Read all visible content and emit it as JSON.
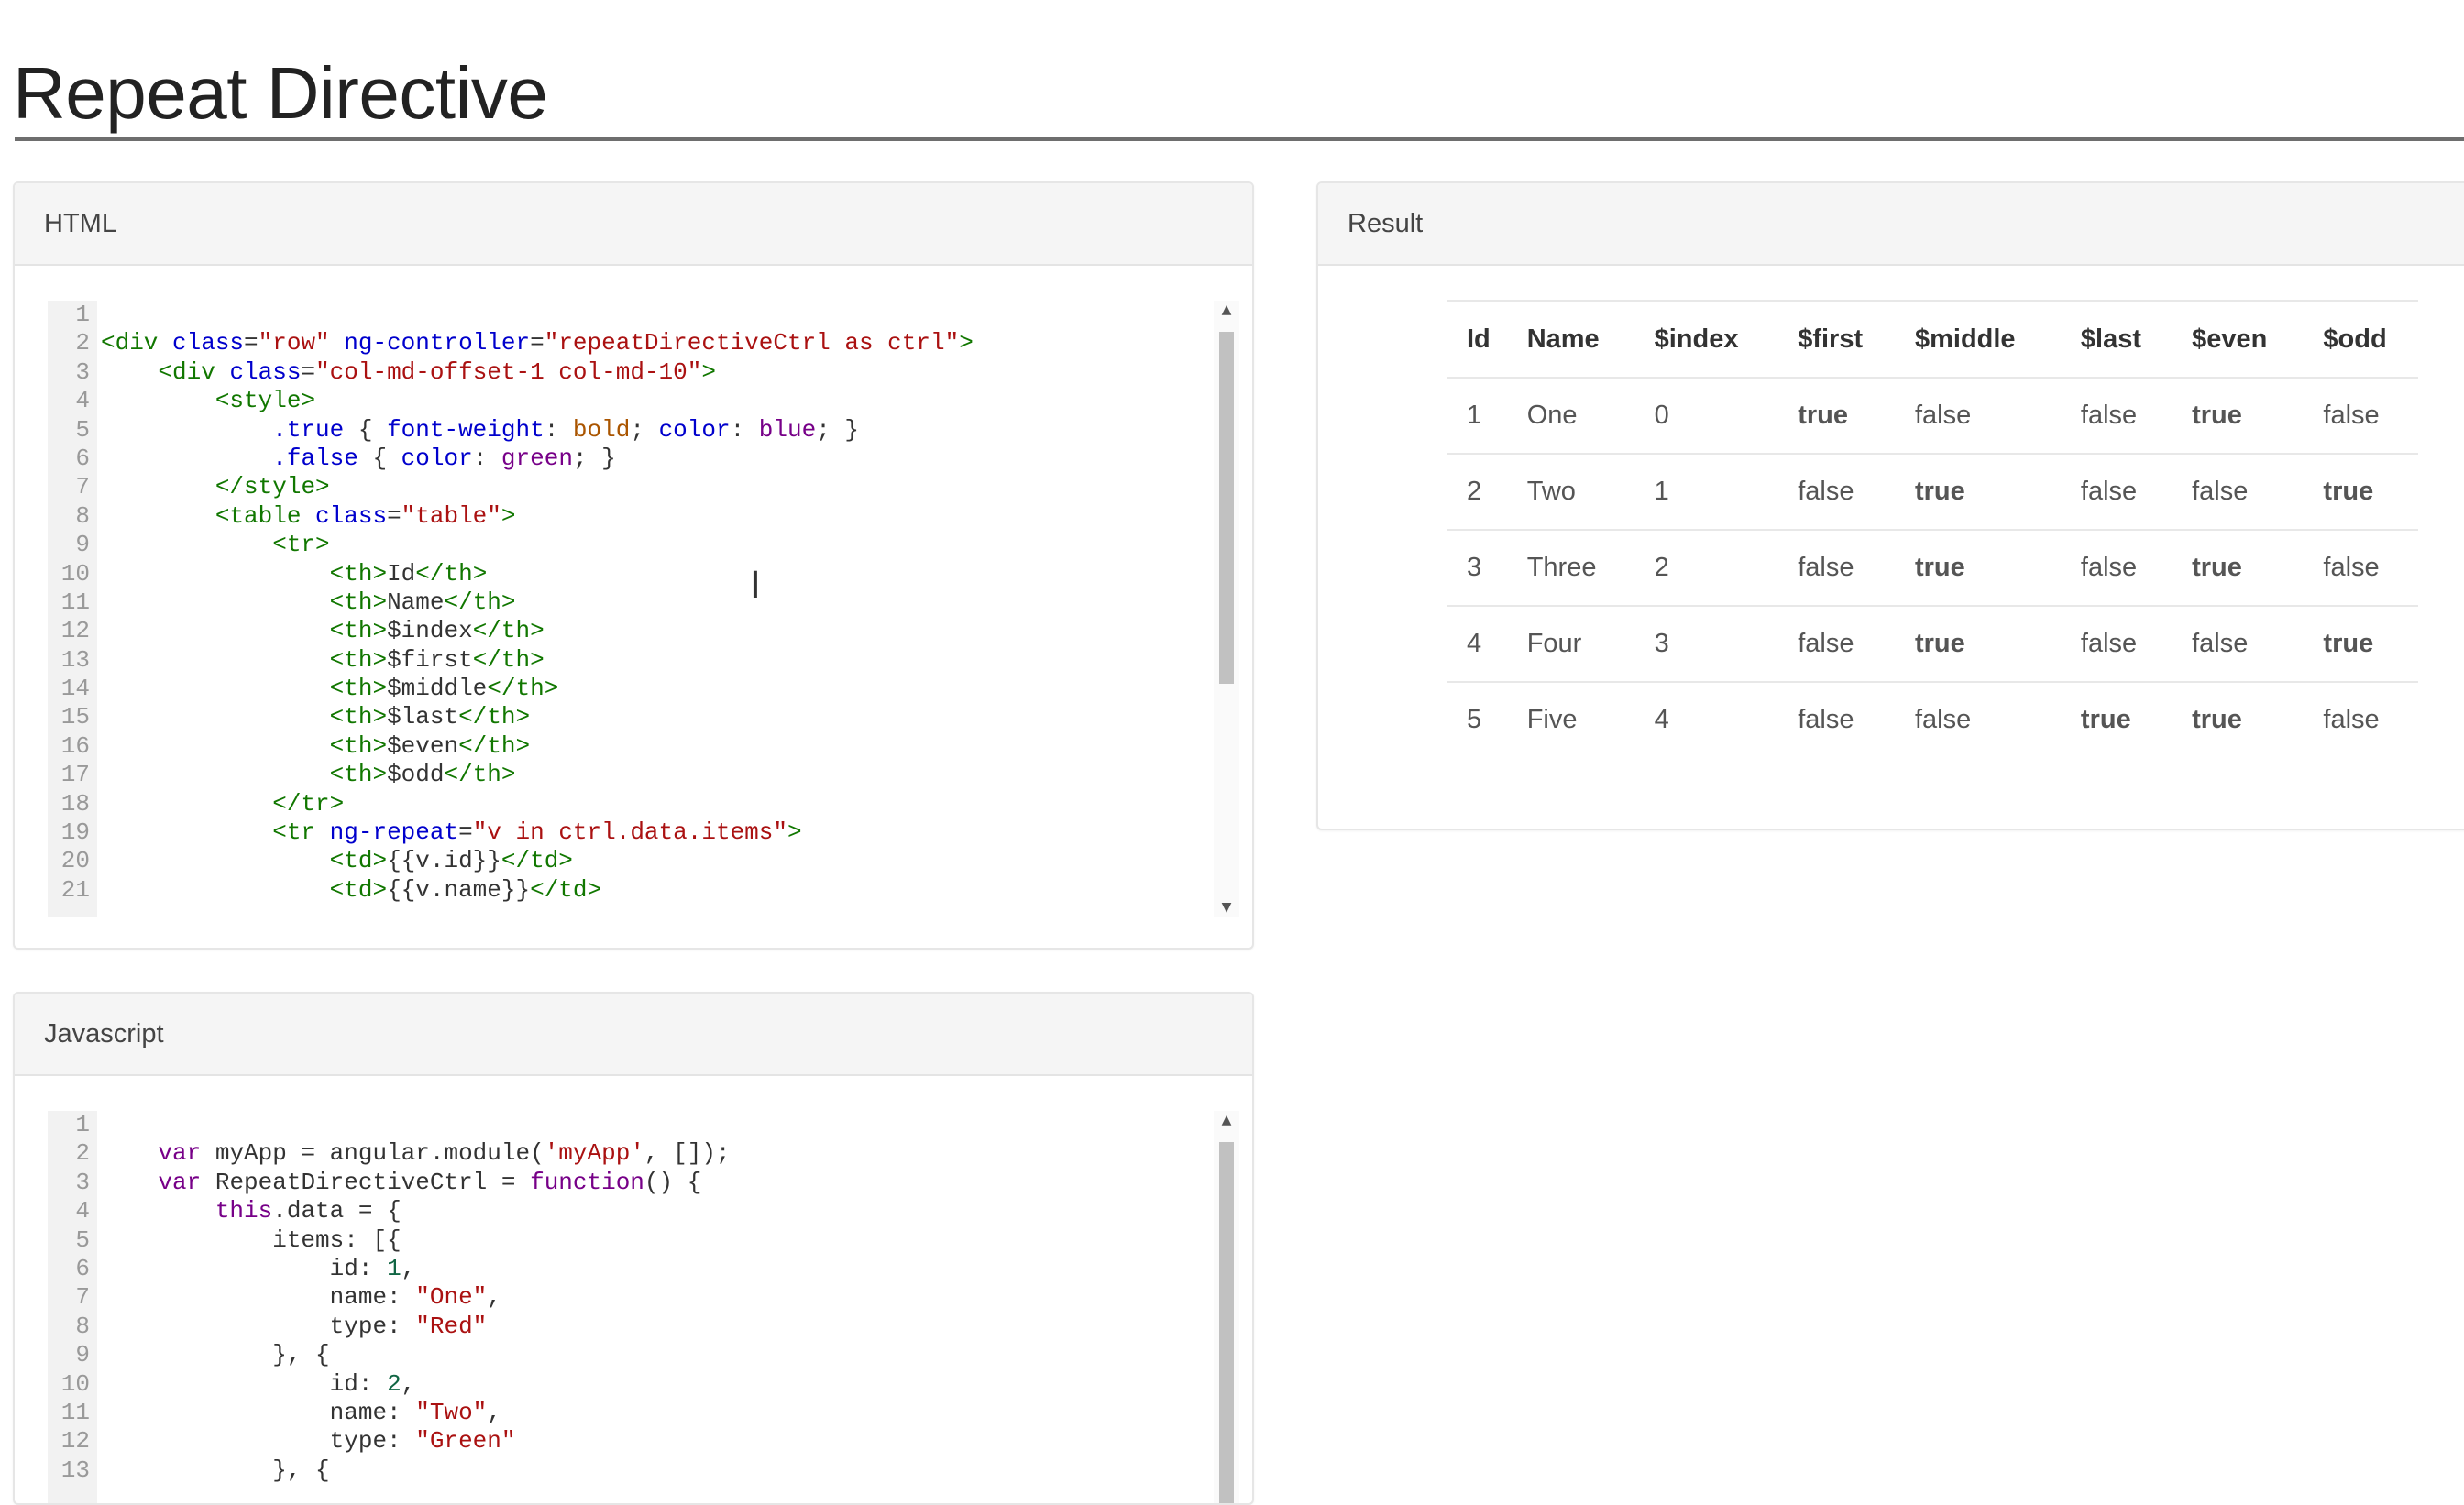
{
  "page": {
    "title": "Repeat Directive"
  },
  "html_panel": {
    "heading": "HTML",
    "line_numbers": [
      "1",
      "2",
      "3",
      "4",
      "5",
      "6",
      "7",
      "8",
      "9",
      "10",
      "11",
      "12",
      "13",
      "14",
      "15",
      "16",
      "17",
      "18",
      "19",
      "20",
      "21"
    ],
    "code_lines": [
      [],
      [
        {
          "t": "tag",
          "v": "<div "
        },
        {
          "t": "attr",
          "v": "class"
        },
        {
          "t": "",
          "v": "="
        },
        {
          "t": "str",
          "v": "\"row\""
        },
        {
          "t": "",
          "v": " "
        },
        {
          "t": "attr",
          "v": "ng-controller"
        },
        {
          "t": "",
          "v": "="
        },
        {
          "t": "str",
          "v": "\"repeatDirectiveCtrl as ctrl\""
        },
        {
          "t": "tag",
          "v": ">"
        }
      ],
      [
        {
          "t": "",
          "v": "    "
        },
        {
          "t": "tag",
          "v": "<div "
        },
        {
          "t": "attr",
          "v": "class"
        },
        {
          "t": "",
          "v": "="
        },
        {
          "t": "str",
          "v": "\"col-md-offset-1 col-md-10\""
        },
        {
          "t": "tag",
          "v": ">"
        }
      ],
      [
        {
          "t": "",
          "v": "        "
        },
        {
          "t": "tag",
          "v": "<style>"
        }
      ],
      [
        {
          "t": "",
          "v": "            "
        },
        {
          "t": "attr",
          "v": ".true"
        },
        {
          "t": "",
          "v": " { "
        },
        {
          "t": "cssprop",
          "v": "font-weight"
        },
        {
          "t": "",
          "v": ": "
        },
        {
          "t": "cssval",
          "v": "bold"
        },
        {
          "t": "",
          "v": "; "
        },
        {
          "t": "cssprop",
          "v": "color"
        },
        {
          "t": "",
          "v": ": "
        },
        {
          "t": "kw",
          "v": "blue"
        },
        {
          "t": "",
          "v": "; }"
        }
      ],
      [
        {
          "t": "",
          "v": "            "
        },
        {
          "t": "attr",
          "v": ".false"
        },
        {
          "t": "",
          "v": " { "
        },
        {
          "t": "cssprop",
          "v": "color"
        },
        {
          "t": "",
          "v": ": "
        },
        {
          "t": "kw",
          "v": "green"
        },
        {
          "t": "",
          "v": "; }"
        }
      ],
      [
        {
          "t": "",
          "v": "        "
        },
        {
          "t": "tag",
          "v": "</style>"
        }
      ],
      [
        {
          "t": "",
          "v": "        "
        },
        {
          "t": "tag",
          "v": "<table "
        },
        {
          "t": "attr",
          "v": "class"
        },
        {
          "t": "",
          "v": "="
        },
        {
          "t": "str",
          "v": "\"table\""
        },
        {
          "t": "tag",
          "v": ">"
        }
      ],
      [
        {
          "t": "",
          "v": "            "
        },
        {
          "t": "tag",
          "v": "<tr>"
        }
      ],
      [
        {
          "t": "",
          "v": "                "
        },
        {
          "t": "tag",
          "v": "<th>"
        },
        {
          "t": "",
          "v": "Id"
        },
        {
          "t": "tag",
          "v": "</th>"
        }
      ],
      [
        {
          "t": "",
          "v": "                "
        },
        {
          "t": "tag",
          "v": "<th>"
        },
        {
          "t": "",
          "v": "Name"
        },
        {
          "t": "tag",
          "v": "</th>"
        }
      ],
      [
        {
          "t": "",
          "v": "                "
        },
        {
          "t": "tag",
          "v": "<th>"
        },
        {
          "t": "",
          "v": "$index"
        },
        {
          "t": "tag",
          "v": "</th>"
        }
      ],
      [
        {
          "t": "",
          "v": "                "
        },
        {
          "t": "tag",
          "v": "<th>"
        },
        {
          "t": "",
          "v": "$first"
        },
        {
          "t": "tag",
          "v": "</th>"
        }
      ],
      [
        {
          "t": "",
          "v": "                "
        },
        {
          "t": "tag",
          "v": "<th>"
        },
        {
          "t": "",
          "v": "$middle"
        },
        {
          "t": "tag",
          "v": "</th>"
        }
      ],
      [
        {
          "t": "",
          "v": "                "
        },
        {
          "t": "tag",
          "v": "<th>"
        },
        {
          "t": "",
          "v": "$last"
        },
        {
          "t": "tag",
          "v": "</th>"
        }
      ],
      [
        {
          "t": "",
          "v": "                "
        },
        {
          "t": "tag",
          "v": "<th>"
        },
        {
          "t": "",
          "v": "$even"
        },
        {
          "t": "tag",
          "v": "</th>"
        }
      ],
      [
        {
          "t": "",
          "v": "                "
        },
        {
          "t": "tag",
          "v": "<th>"
        },
        {
          "t": "",
          "v": "$odd"
        },
        {
          "t": "tag",
          "v": "</th>"
        }
      ],
      [
        {
          "t": "",
          "v": "            "
        },
        {
          "t": "tag",
          "v": "</tr>"
        }
      ],
      [
        {
          "t": "",
          "v": "            "
        },
        {
          "t": "tag",
          "v": "<tr "
        },
        {
          "t": "attr",
          "v": "ng-repeat"
        },
        {
          "t": "",
          "v": "="
        },
        {
          "t": "str",
          "v": "\"v in ctrl.data.items\""
        },
        {
          "t": "tag",
          "v": ">"
        }
      ],
      [
        {
          "t": "",
          "v": "                "
        },
        {
          "t": "tag",
          "v": "<td>"
        },
        {
          "t": "",
          "v": "{{v.id}}"
        },
        {
          "t": "tag",
          "v": "</td>"
        }
      ],
      [
        {
          "t": "",
          "v": "                "
        },
        {
          "t": "tag",
          "v": "<td>"
        },
        {
          "t": "",
          "v": "{{v.name}}"
        },
        {
          "t": "tag",
          "v": "</td>"
        }
      ]
    ]
  },
  "js_panel": {
    "heading": "Javascript",
    "line_numbers": [
      "1",
      "2",
      "3",
      "4",
      "5",
      "6",
      "7",
      "8",
      "9",
      "10",
      "11",
      "12",
      "13"
    ],
    "code_lines": [
      [],
      [
        {
          "t": "",
          "v": "    "
        },
        {
          "t": "kw",
          "v": "var"
        },
        {
          "t": "",
          "v": " myApp = angular.module("
        },
        {
          "t": "str",
          "v": "'myApp'"
        },
        {
          "t": "",
          "v": ", []);"
        }
      ],
      [
        {
          "t": "",
          "v": "    "
        },
        {
          "t": "kw",
          "v": "var"
        },
        {
          "t": "",
          "v": " RepeatDirectiveCtrl = "
        },
        {
          "t": "kw",
          "v": "function"
        },
        {
          "t": "",
          "v": "() {"
        }
      ],
      [
        {
          "t": "",
          "v": "        "
        },
        {
          "t": "kw",
          "v": "this"
        },
        {
          "t": "",
          "v": ".data = {"
        }
      ],
      [
        {
          "t": "",
          "v": "            items: [{"
        }
      ],
      [
        {
          "t": "",
          "v": "                id: "
        },
        {
          "t": "num",
          "v": "1"
        },
        {
          "t": "",
          "v": ","
        }
      ],
      [
        {
          "t": "",
          "v": "                name: "
        },
        {
          "t": "str",
          "v": "\"One\""
        },
        {
          "t": "",
          "v": ","
        }
      ],
      [
        {
          "t": "",
          "v": "                type: "
        },
        {
          "t": "str",
          "v": "\"Red\""
        }
      ],
      [
        {
          "t": "",
          "v": "            }, {"
        }
      ],
      [
        {
          "t": "",
          "v": "                id: "
        },
        {
          "t": "num",
          "v": "2"
        },
        {
          "t": "",
          "v": ","
        }
      ],
      [
        {
          "t": "",
          "v": "                name: "
        },
        {
          "t": "str",
          "v": "\"Two\""
        },
        {
          "t": "",
          "v": ","
        }
      ],
      [
        {
          "t": "",
          "v": "                type: "
        },
        {
          "t": "str",
          "v": "\"Green\""
        }
      ],
      [
        {
          "t": "",
          "v": "            }, {"
        }
      ]
    ]
  },
  "result_panel": {
    "heading": "Result",
    "columns": [
      "Id",
      "Name",
      "$index",
      "$first",
      "$middle",
      "$last",
      "$even",
      "$odd"
    ],
    "rows": [
      [
        "1",
        "One",
        "0",
        "true",
        "false",
        "false",
        "true",
        "false"
      ],
      [
        "2",
        "Two",
        "1",
        "false",
        "true",
        "false",
        "false",
        "true"
      ],
      [
        "3",
        "Three",
        "2",
        "false",
        "true",
        "false",
        "true",
        "false"
      ],
      [
        "4",
        "Four",
        "3",
        "false",
        "true",
        "false",
        "false",
        "true"
      ],
      [
        "5",
        "Five",
        "4",
        "false",
        "false",
        "true",
        "true",
        "false"
      ]
    ]
  },
  "colors": {
    "true": "#0000ee",
    "false": "#118811"
  }
}
